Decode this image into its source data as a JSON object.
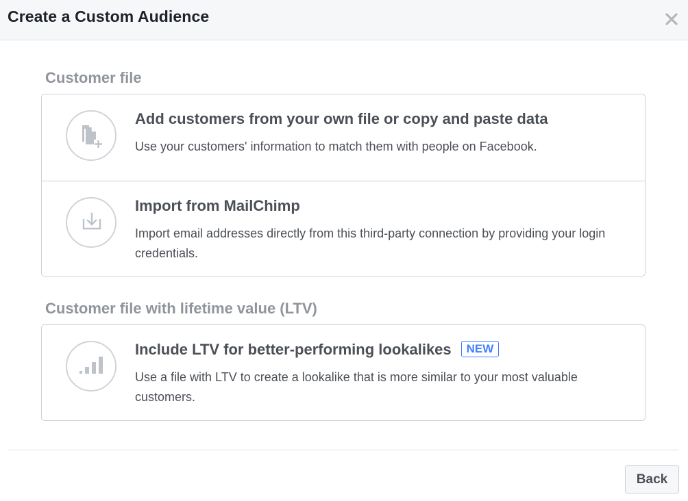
{
  "dialog": {
    "title": "Create a Custom Audience",
    "close_icon": "close-icon"
  },
  "sections": [
    {
      "title": "Customer file",
      "options": [
        {
          "icon": "file-add-icon",
          "title": "Add customers from your own file or copy and paste data",
          "description": "Use your customers' information to match them with people on Facebook."
        },
        {
          "icon": "import-icon",
          "title": "Import from MailChimp",
          "description": "Import email addresses directly from this third-party connection by providing your login credentials."
        }
      ]
    },
    {
      "title": "Customer file with lifetime value (LTV)",
      "options": [
        {
          "icon": "bar-chart-icon",
          "title": "Include LTV for better-performing lookalikes",
          "badge": "NEW",
          "description": "Use a file with LTV to create a lookalike that is more similar to your most valuable customers."
        }
      ]
    }
  ],
  "footer": {
    "back_label": "Back"
  },
  "colors": {
    "accent": "#4080ff",
    "text": "#4b4f56",
    "muted": "#90949c",
    "border": "#ccd0d5",
    "header_bg": "#f6f7f9"
  }
}
